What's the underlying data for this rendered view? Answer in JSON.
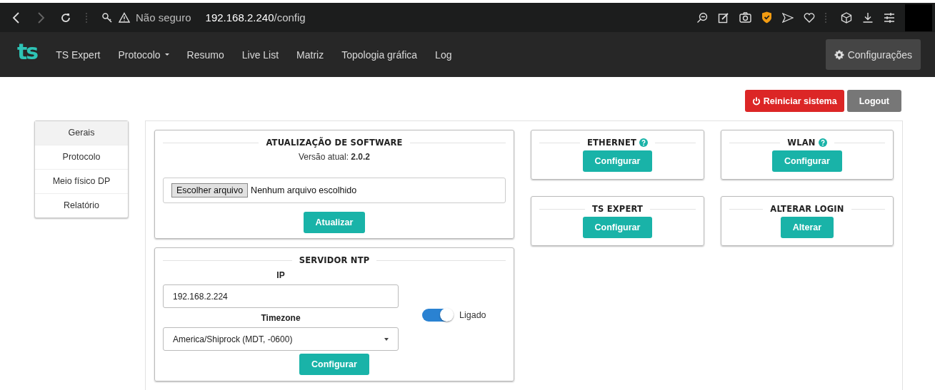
{
  "browser": {
    "security_label": "Não seguro",
    "url_host": "192.168.2.240",
    "url_path": "/config"
  },
  "nav": {
    "logo": "ts",
    "items": [
      {
        "label": "TS Expert",
        "dropdown": false
      },
      {
        "label": "Protocolo",
        "dropdown": true
      },
      {
        "label": "Resumo",
        "dropdown": false
      },
      {
        "label": "Live List",
        "dropdown": false
      },
      {
        "label": "Matriz",
        "dropdown": false
      },
      {
        "label": "Topologia gráfica",
        "dropdown": false
      },
      {
        "label": "Log",
        "dropdown": false
      }
    ],
    "settings_button": "Configurações"
  },
  "actions": [
    {
      "label": "Reiniciar sistema",
      "kind": "danger"
    },
    {
      "label": "Logout",
      "kind": "secondary"
    }
  ],
  "sidebar": {
    "items": [
      {
        "label": "Gerais",
        "selected": true
      },
      {
        "label": "Protocolo",
        "selected": false
      },
      {
        "label": "Meio físico DP",
        "selected": false
      },
      {
        "label": "Relatório",
        "selected": false
      }
    ]
  },
  "software_update": {
    "title": "ATUALIZAÇÃO DE SOFTWARE",
    "version": "Versão atual: **2.0.2**",
    "file_button": "Escolher arquivo",
    "file_status": "Nenhum arquivo escolhido",
    "button": "Atualizar"
  },
  "ntp": {
    "title": "SERVIDOR NTP",
    "ip_label": "IP",
    "ip_value": "192.168.2.224",
    "timezone_label": "Timezone",
    "timezone_value": "America/Shiprock (MDT, -0600)",
    "toggle": {
      "on": true,
      "label": "Ligado"
    },
    "button": "Configurar"
  },
  "cards": [
    {
      "title": "ETHERNET",
      "help": true,
      "button": "Configurar"
    },
    {
      "title": "WLAN",
      "help": true,
      "button": "Configurar"
    },
    {
      "title": "TS EXPERT",
      "help": false,
      "button": "Configurar"
    },
    {
      "title": "ALTERAR LOGIN",
      "help": false,
      "button": "Alterar"
    }
  ]
}
